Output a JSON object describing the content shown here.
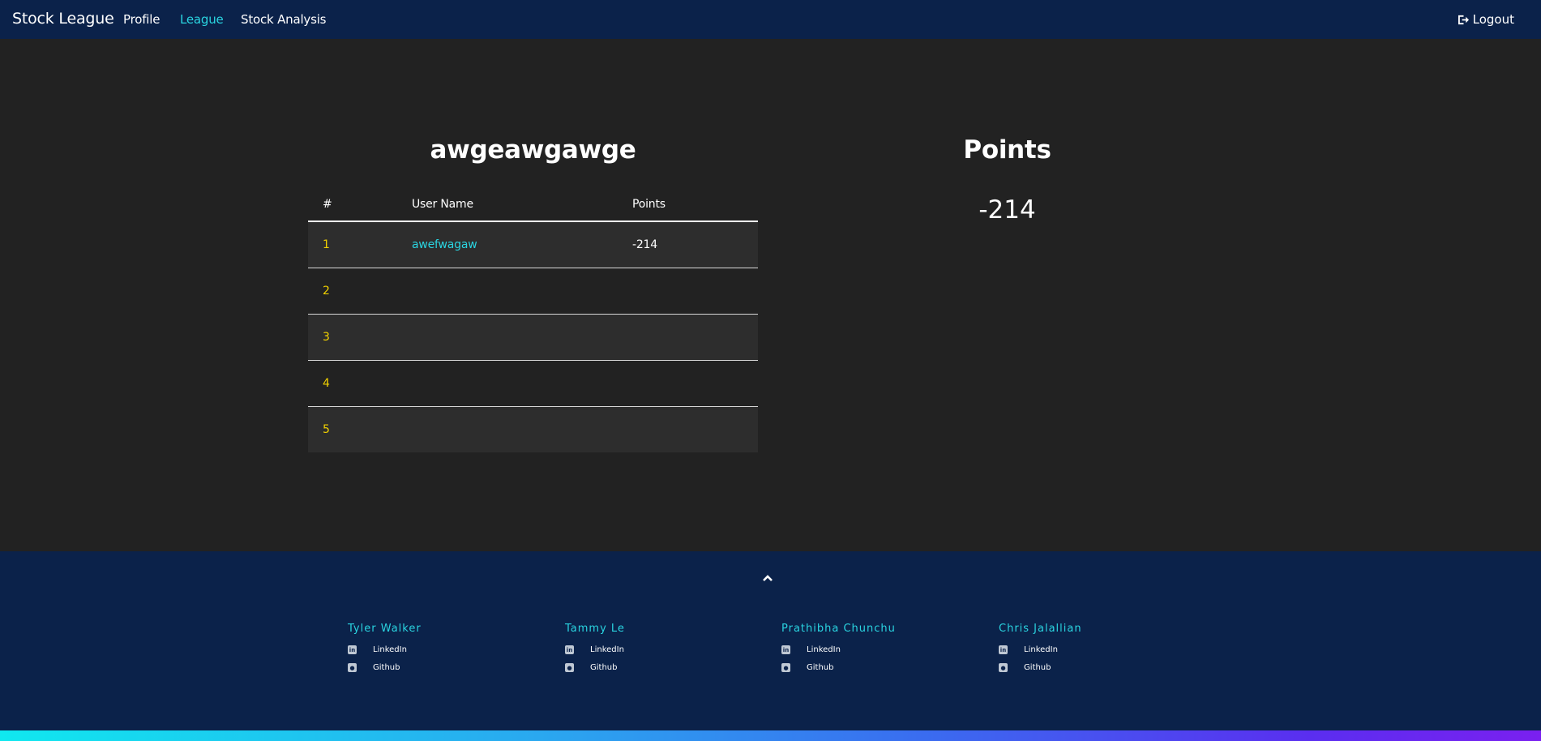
{
  "nav": {
    "brand": "Stock League",
    "links": [
      "Profile",
      "League",
      "Stock Analysis"
    ],
    "active_index": 1,
    "logout_label": "Logout",
    "logout_icon": "sign-out-icon"
  },
  "league": {
    "title": "awgeawgawge",
    "columns": [
      "#",
      "User Name",
      "Points"
    ],
    "rows": [
      {
        "rank": "1",
        "user": "awefwagaw",
        "points": "-214"
      },
      {
        "rank": "2",
        "user": "",
        "points": ""
      },
      {
        "rank": "3",
        "user": "",
        "points": ""
      },
      {
        "rank": "4",
        "user": "",
        "points": ""
      },
      {
        "rank": "5",
        "user": "",
        "points": ""
      }
    ]
  },
  "points_panel": {
    "title": "Points",
    "value": "-214"
  },
  "footer": {
    "scroll_top_icon": "chevron-up-icon",
    "members": [
      {
        "name": "Tyler Walker",
        "links": [
          "LinkedIn",
          "Github"
        ]
      },
      {
        "name": "Tammy Le",
        "links": [
          "LinkedIn",
          "Github"
        ]
      },
      {
        "name": "Prathibha Chunchu",
        "links": [
          "LinkedIn",
          "Github"
        ]
      },
      {
        "name": "Chris Jalallian",
        "links": [
          "LinkedIn",
          "Github"
        ]
      }
    ]
  },
  "colors": {
    "navbar_bg": "#0b224a",
    "page_bg": "#222222",
    "accent": "#2ad4e0",
    "rank_color": "#f0d000"
  }
}
